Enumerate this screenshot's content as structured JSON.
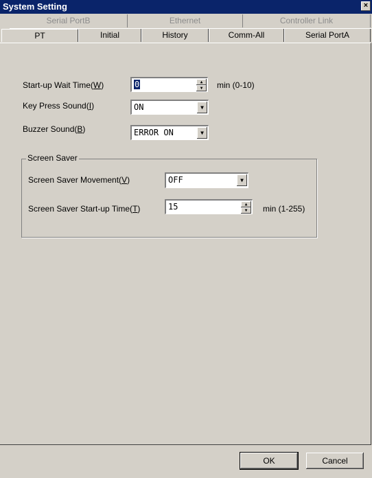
{
  "window": {
    "title": "System Setting",
    "close": "×"
  },
  "tabs_back": [
    {
      "label": "Serial PortB"
    },
    {
      "label": "Ethernet"
    },
    {
      "label": "Controller Link"
    }
  ],
  "tabs_front": [
    {
      "label": "PT"
    },
    {
      "label": "Initial"
    },
    {
      "label": "History"
    },
    {
      "label": "Comm-All"
    },
    {
      "label": "Serial PortA"
    }
  ],
  "active_tab": "PT",
  "startup_wait": {
    "label_pre": "Start-up Wait Time(",
    "key": "W",
    "label_post": ")",
    "value": "0",
    "unit": "min (0-10)"
  },
  "key_press": {
    "label_pre": "Key Press Sound(",
    "key": "I",
    "label_post": ")",
    "value": "ON"
  },
  "buzzer": {
    "label_pre": "Buzzer Sound(",
    "key": "B",
    "label_post": ")",
    "value": "ERROR ON"
  },
  "screen_saver": {
    "group_title": "Screen Saver",
    "movement": {
      "label_pre": "Screen Saver Movement(",
      "key": "V",
      "label_post": ")",
      "value": "OFF"
    },
    "startup": {
      "label_pre": "Screen Saver Start-up Time(",
      "key": "T",
      "label_post": ")",
      "value": "15",
      "unit": "min (1-255)"
    }
  },
  "buttons": {
    "ok": "OK",
    "cancel": "Cancel"
  },
  "icons": {
    "spin_up": "▲",
    "spin_down": "▼",
    "dropdown": "▼"
  }
}
